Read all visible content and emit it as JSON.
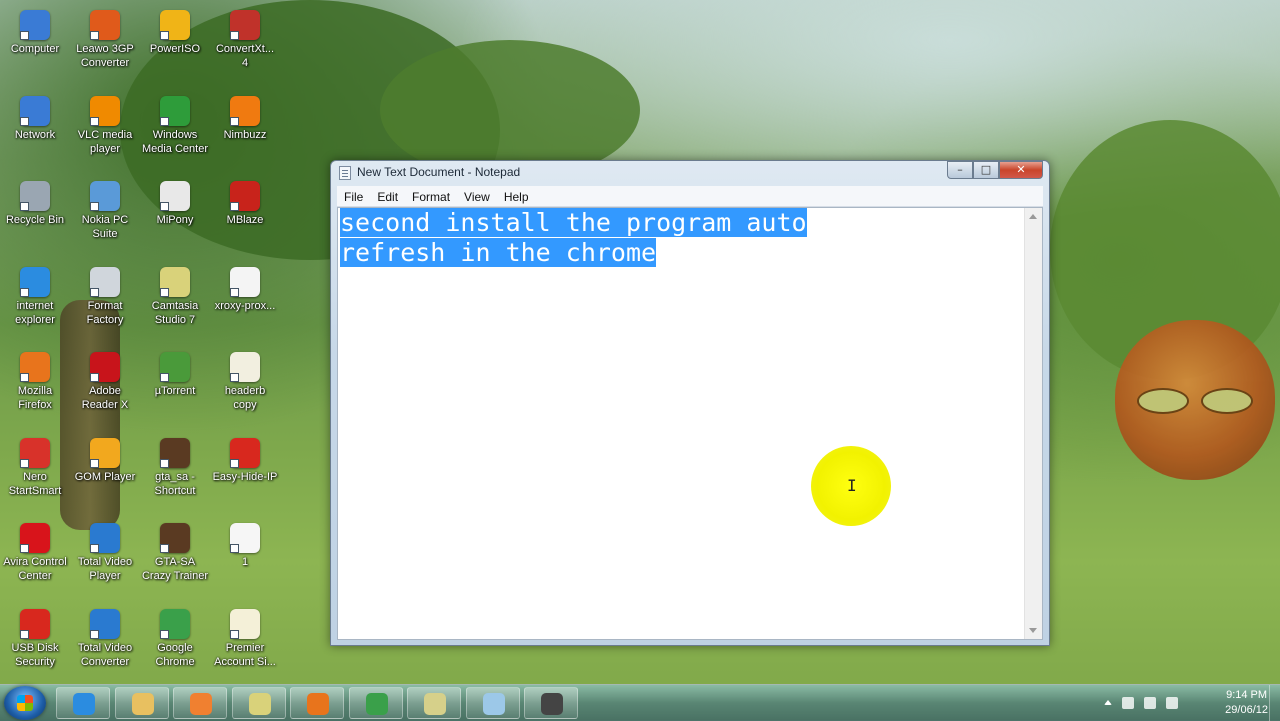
{
  "desktop": {
    "icons": [
      {
        "label": "Computer",
        "icon": "computer-icon",
        "color": "#3a7bd5"
      },
      {
        "label": "Leawo 3GP\nConverter",
        "icon": "leawo-icon",
        "color": "#e05a1b"
      },
      {
        "label": "PowerISO",
        "icon": "poweriso-icon",
        "color": "#f0b417"
      },
      {
        "label": "ConvertXt...\n4",
        "icon": "convertx-icon",
        "color": "#c0322a"
      },
      {
        "label": "Network",
        "icon": "network-icon",
        "color": "#3a7bd5"
      },
      {
        "label": "VLC media\nplayer",
        "icon": "vlc-icon",
        "color": "#f08a00"
      },
      {
        "label": "Windows\nMedia Center",
        "icon": "media-center-icon",
        "color": "#2e9c3a"
      },
      {
        "label": "Nimbuzz",
        "icon": "nimbuzz-icon",
        "color": "#f07a10"
      },
      {
        "label": "Recycle Bin",
        "icon": "recycle-bin-icon",
        "color": "#9aa6b2"
      },
      {
        "label": "Nokia PC\nSuite",
        "icon": "nokia-icon",
        "color": "#5a9ad8"
      },
      {
        "label": "MiPony",
        "icon": "mipony-icon",
        "color": "#e8e8e8"
      },
      {
        "label": "MBlaze",
        "icon": "mblaze-icon",
        "color": "#c8231b"
      },
      {
        "label": "internet\nexplorer",
        "icon": "internet-explorer-icon",
        "color": "#2b8ce0"
      },
      {
        "label": "Format\nFactory",
        "icon": "format-factory-icon",
        "color": "#d0d6dc"
      },
      {
        "label": "Camtasia\nStudio 7",
        "icon": "camtasia-icon",
        "color": "#d9d27a"
      },
      {
        "label": "xroxy-prox...",
        "icon": "file-icon",
        "color": "#f4f4f4"
      },
      {
        "label": "Mozilla\nFirefox",
        "icon": "firefox-icon",
        "color": "#e8741c"
      },
      {
        "label": "Adobe\nReader X",
        "icon": "adobe-reader-icon",
        "color": "#c8141b"
      },
      {
        "label": "µTorrent",
        "icon": "utorrent-icon",
        "color": "#4a9a3a"
      },
      {
        "label": "headerb\ncopy",
        "icon": "image-file-icon",
        "color": "#f2efe0"
      },
      {
        "label": "Nero\nStartSmart",
        "icon": "nero-icon",
        "color": "#d8322a"
      },
      {
        "label": "GOM Player",
        "icon": "gom-player-icon",
        "color": "#f2a81e"
      },
      {
        "label": "gta_sa -\nShortcut",
        "icon": "gta-icon",
        "color": "#5a3a22"
      },
      {
        "label": "Easy-Hide-IP",
        "icon": "easy-hide-ip-icon",
        "color": "#d8281e"
      },
      {
        "label": "Avira Control\nCenter",
        "icon": "avira-icon",
        "color": "#d8141b"
      },
      {
        "label": "Total Video\nPlayer",
        "icon": "total-video-player-icon",
        "color": "#2a7ad0"
      },
      {
        "label": "GTA-SA\nCrazy Trainer",
        "icon": "gta-trainer-icon",
        "color": "#5a3a22"
      },
      {
        "label": "1",
        "icon": "text-file-icon",
        "color": "#f6f6f6"
      },
      {
        "label": "USB Disk\nSecurity",
        "icon": "usb-disk-security-icon",
        "color": "#d8281e"
      },
      {
        "label": "Total Video\nConverter",
        "icon": "total-video-converter-icon",
        "color": "#2a7ad0"
      },
      {
        "label": "Google\nChrome",
        "icon": "chrome-icon",
        "color": "#3aa04a"
      },
      {
        "label": "Premier\nAccount Si...",
        "icon": "document-icon",
        "color": "#f4f0d8"
      }
    ]
  },
  "notepad": {
    "title": "New Text Document - Notepad",
    "menu": [
      "File",
      "Edit",
      "Format",
      "View",
      "Help"
    ],
    "content_line1": "second install the program auto",
    "content_line2": "refresh in the chrome",
    "selection_color": "#3399ff",
    "controls": {
      "minimize": "–",
      "maximize": "□",
      "close": "✕"
    }
  },
  "cursor": {
    "glyph": "I"
  },
  "taskbar": {
    "buttons": [
      {
        "icon": "internet-explorer-icon",
        "color": "#2b8ce0"
      },
      {
        "icon": "file-explorer-icon",
        "color": "#e8c060"
      },
      {
        "icon": "media-player-icon",
        "color": "#f08030"
      },
      {
        "icon": "camtasia-icon",
        "color": "#d9d27a"
      },
      {
        "icon": "firefox-icon",
        "color": "#e8741c"
      },
      {
        "icon": "chrome-icon",
        "color": "#3aa04a"
      },
      {
        "icon": "folder-icon",
        "color": "#d6d08a"
      },
      {
        "icon": "notepad-icon",
        "color": "#9cc8e8"
      },
      {
        "icon": "video-camera-icon",
        "color": "#444444"
      }
    ],
    "clock_time": "9:14 PM",
    "clock_date": "29/06/12"
  }
}
